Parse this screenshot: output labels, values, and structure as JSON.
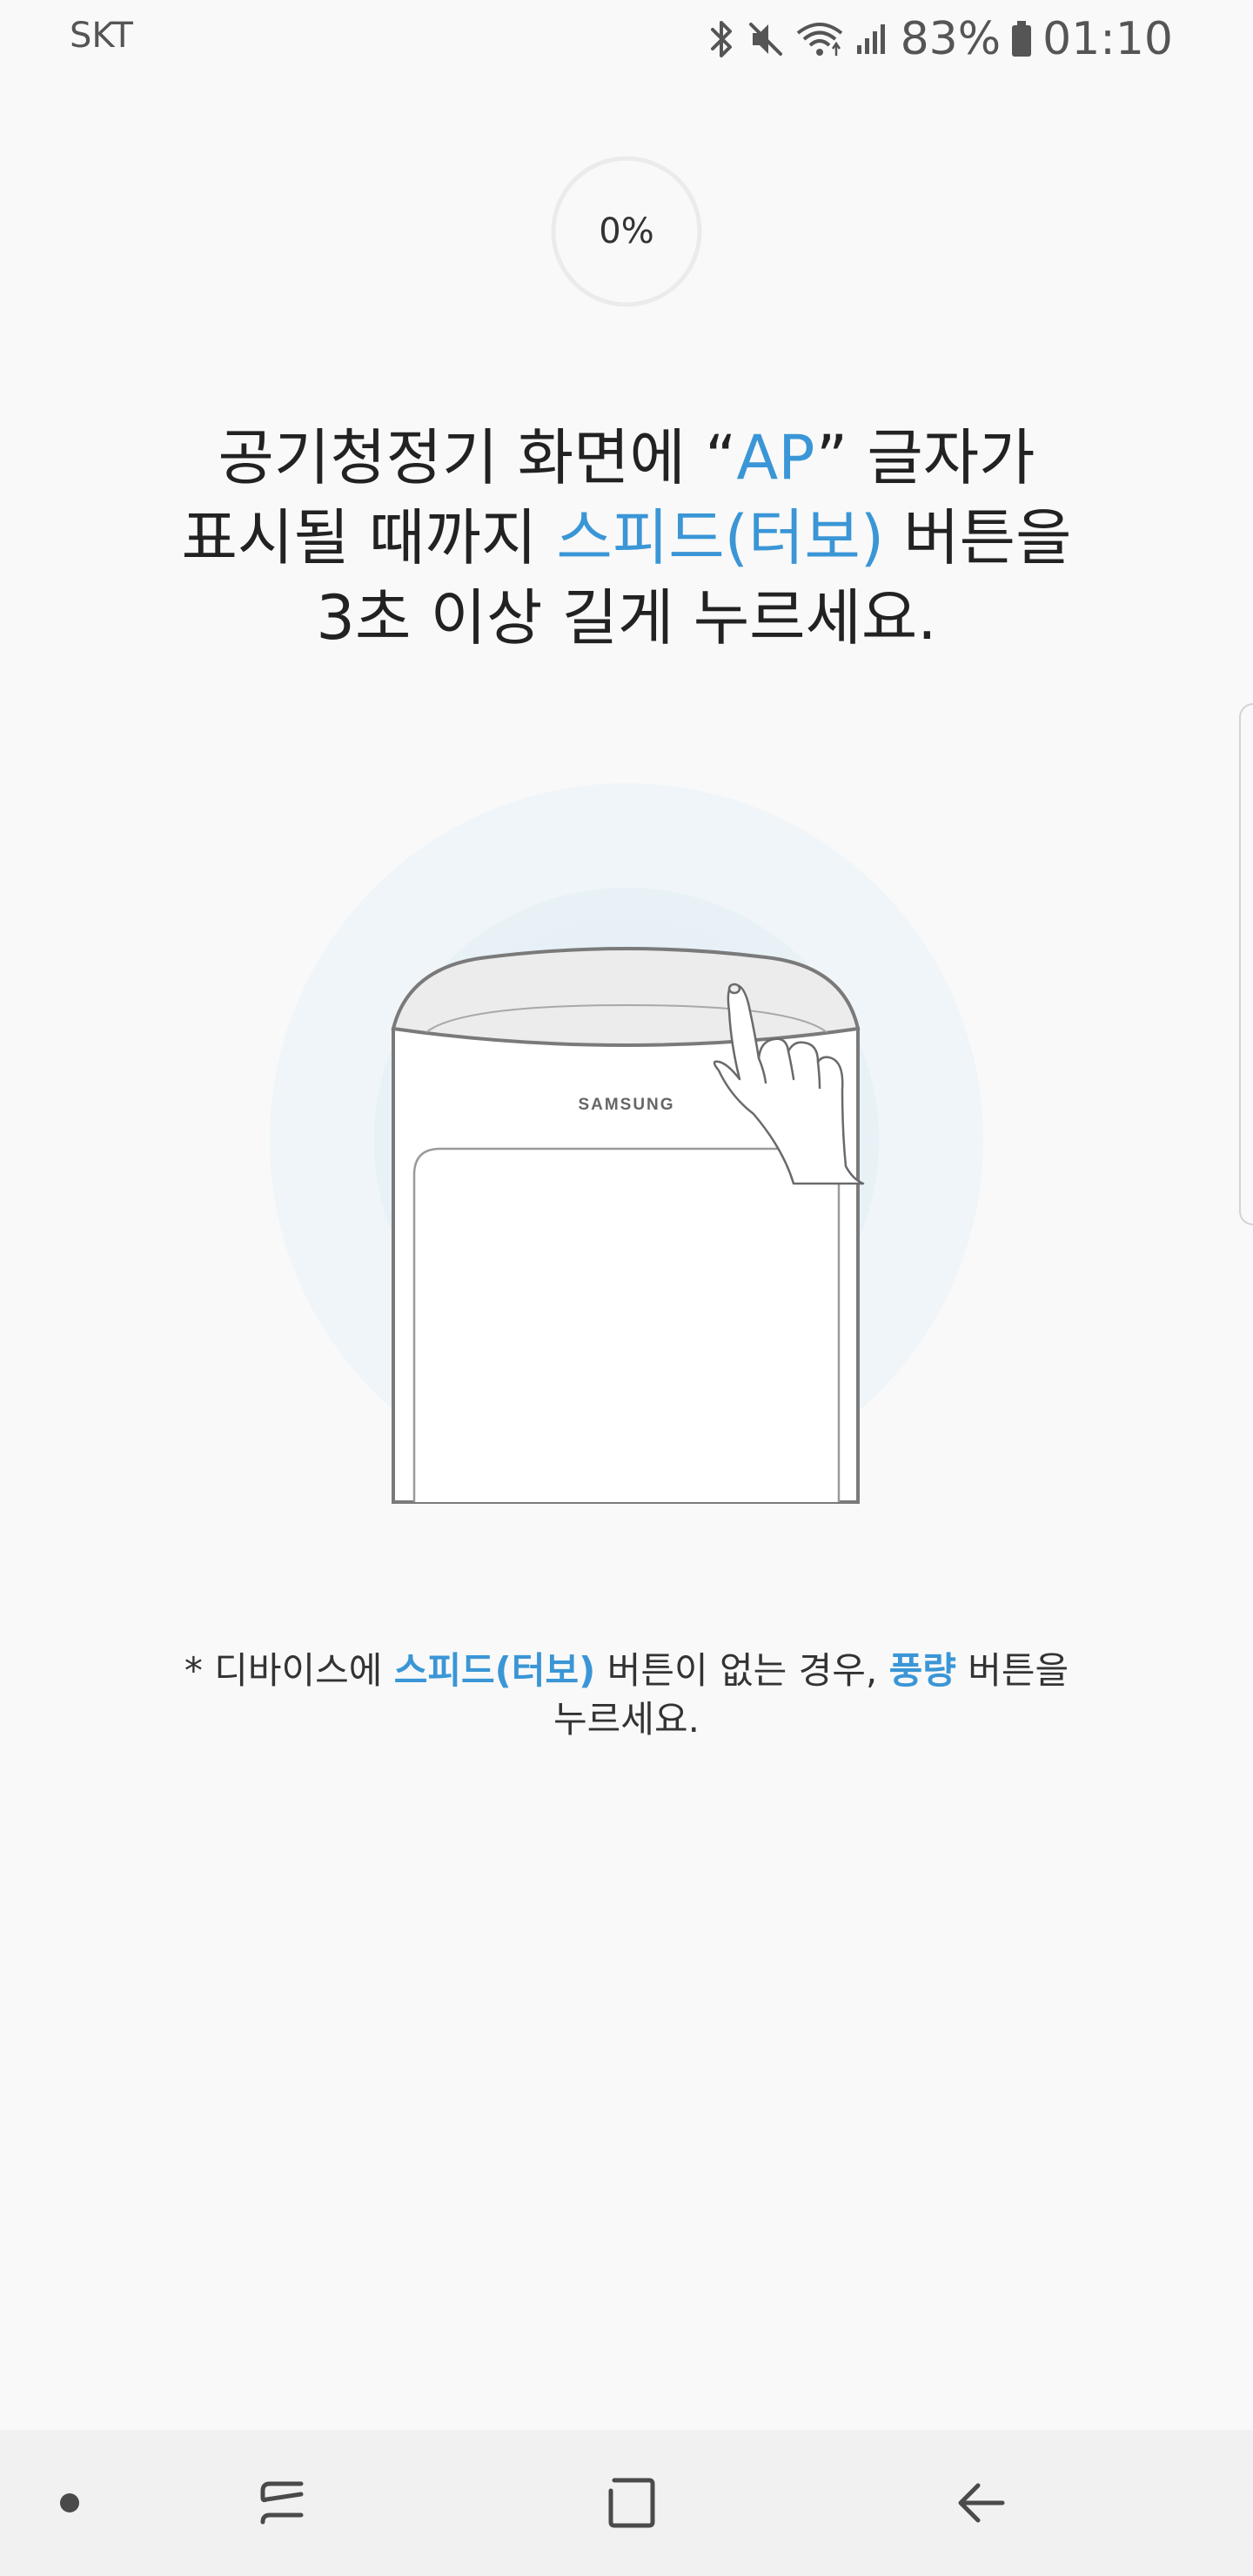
{
  "status_bar": {
    "carrier": "SKT",
    "icons": [
      "bluetooth-icon",
      "mute-icon",
      "wifi-icon",
      "signal-icon",
      "battery-icon"
    ],
    "battery": "83%",
    "time": "01:10"
  },
  "progress": {
    "label": "0%",
    "value": 0
  },
  "instruction": {
    "line1_a": "공기청정기 화면에 “",
    "line1_hl": "AP",
    "line1_b": "” 글자가",
    "line2_a": "표시될 때까지 ",
    "line2_hl": "스피드(터보)",
    "line2_b": " 버튼을",
    "line3": "3초 이상 길게 누르세요."
  },
  "illustration": {
    "brand": "SAMSUNG",
    "accent_color": "#3a96d6"
  },
  "note": {
    "prefix": "* 디바이스에 ",
    "hl1": "스피드(터보)",
    "mid": " 버튼이 없는 경우, ",
    "hl2": "풍량",
    "suffix_line1": " 버튼을",
    "line2": "누르세요."
  },
  "nav_bar": {
    "items": [
      "dot-icon",
      "recent-apps-icon",
      "home-icon",
      "back-icon"
    ]
  }
}
